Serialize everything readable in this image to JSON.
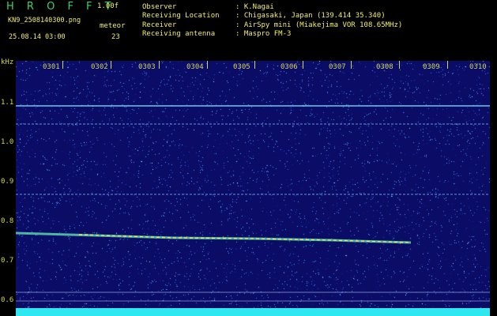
{
  "header": {
    "app_title": "H R O F F T",
    "version": "1.00f",
    "filename": "KN9_2508140300.png",
    "datetime": "25.08.14 03:00",
    "meteor_label": "meteor",
    "meteor_count": "23"
  },
  "info": [
    {
      "key": "Observer",
      "value": ": K.Nagai"
    },
    {
      "key": "Receiving Location",
      "value": ": Chigasaki, Japan (139.414 35.340)"
    },
    {
      "key": "Receiver",
      "value": ": AirSpy mini (Miakejima VOR 108.65MHz)"
    },
    {
      "key": "Receiving antenna",
      "value": ": Maspro FM-3"
    }
  ],
  "spectrogram": {
    "y_unit": "kHz",
    "y_ticks": [
      "1.1",
      "1.0",
      "0.9",
      "0.8",
      "0.7",
      "0.6"
    ],
    "x_ticks": [
      "0301",
      "0302",
      "0303",
      "0304",
      "0305",
      "0306",
      "0307",
      "0308",
      "0309",
      "0310"
    ],
    "colors": {
      "background": "#0a0c66",
      "noise_bright": "#4a7cff",
      "carrier": "#7de9ff",
      "labels": "#d5d54f"
    }
  }
}
